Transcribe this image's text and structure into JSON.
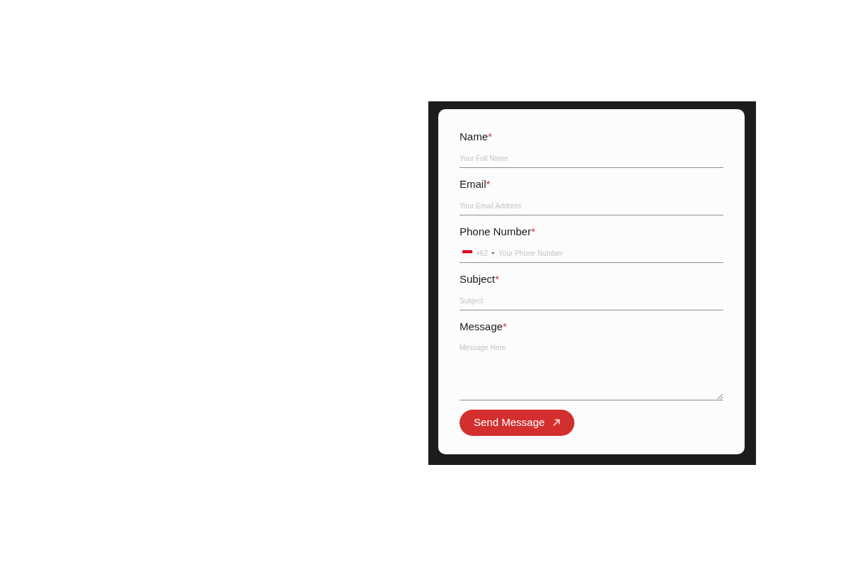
{
  "form": {
    "fields": [
      {
        "kind": "text",
        "label": "Name",
        "required_mark": "*",
        "placeholder": "Your Full Name"
      },
      {
        "kind": "text",
        "label": "Email",
        "required_mark": "*",
        "placeholder": "Your Email Address"
      },
      {
        "kind": "phone",
        "label": "Phone Number",
        "required_mark": "*",
        "dial_code": "+62",
        "placeholder": "Your Phone Number"
      },
      {
        "kind": "text",
        "label": "Subject",
        "required_mark": "*",
        "placeholder": "Subject"
      },
      {
        "kind": "textarea",
        "label": "Message",
        "required_mark": "*",
        "placeholder": "Message Here"
      }
    ],
    "submit": {
      "label": "Send Message"
    }
  }
}
